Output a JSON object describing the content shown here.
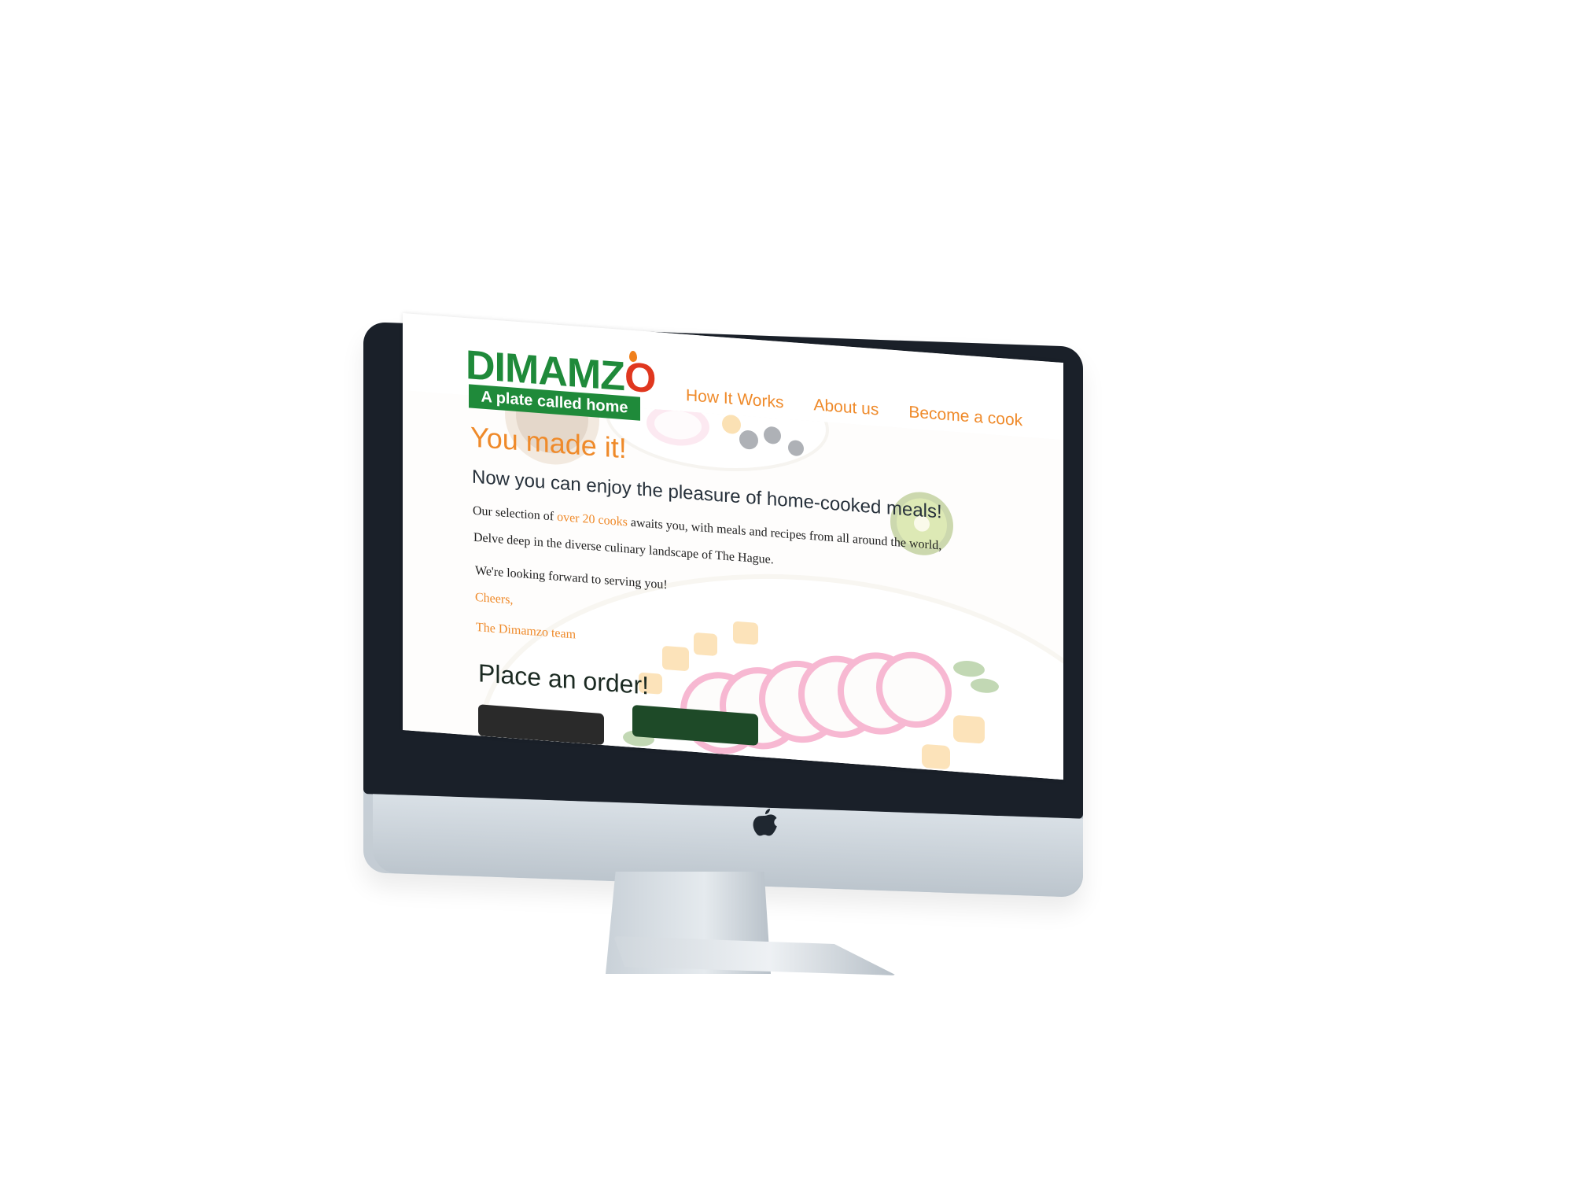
{
  "brand": {
    "logo_word_main": "DIMAMZ",
    "logo_word_end": "O",
    "tagline": "A plate called home",
    "green": "#1f8a3a",
    "red": "#e0371f"
  },
  "nav": {
    "items": [
      "How It Works",
      "About us",
      "Become a cook"
    ],
    "color": "#ef8a2a"
  },
  "hero": {
    "title": "You made it!",
    "subtitle": "Now you can enjoy the pleasure of home-cooked meals!",
    "para1_before": "Our selection of ",
    "para1_highlight": "over 20 cooks",
    "para1_after": " awaits you, with meals and recipes from all around the world,",
    "para2": "Delve deep in the diverse culinary landscape of The Hague.",
    "para3": "We're looking forward to serving you!",
    "sign_off": "Cheers,",
    "signature": "The Dimamzo team",
    "order_heading": "Place an order!",
    "background_image": "fruit-bowl-photo"
  },
  "device": {
    "type": "desktop-monitor-mockup",
    "logo_icon": "apple-icon"
  }
}
